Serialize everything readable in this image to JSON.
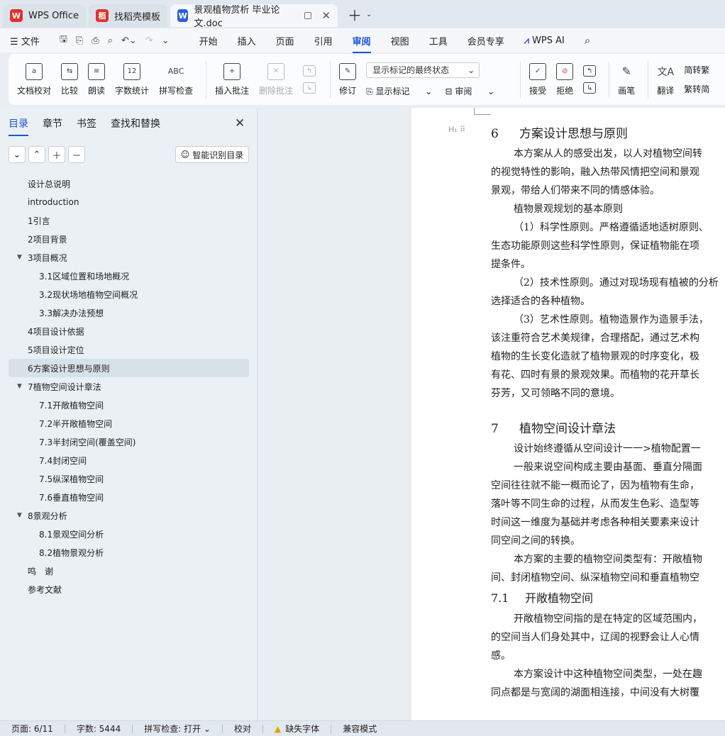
{
  "tabs": [
    {
      "label": "WPS Office",
      "state": "inactive",
      "logo": "W",
      "logo_color": "#e2302d"
    },
    {
      "label": "找稻壳模板",
      "state": "inactive",
      "logo": "稻",
      "logo_color": "#e2302d"
    },
    {
      "label": "景观植物赏析 毕业论文.doc",
      "state": "active",
      "logo": "W",
      "logo_color": "#2b5fd9"
    }
  ],
  "menu": {
    "file": "文件",
    "items": [
      "开始",
      "插入",
      "页面",
      "引用",
      "审阅",
      "视图",
      "工具",
      "会员专享"
    ],
    "active": "审阅",
    "ai": "WPS AI"
  },
  "ribbon": {
    "doc_proof": "文档校对",
    "compare": "比较",
    "read_aloud": "朗读",
    "word_count": "字数统计",
    "spell_check": "拼写检查",
    "insert_comment": "插入批注",
    "delete_comment": "删除批注",
    "track": "修订",
    "markup_view": "显示标记的最终状态",
    "show_markup": "显示标记",
    "review": "审阅",
    "accept": "接受",
    "reject": "拒绝",
    "pen": "画笔",
    "translate": "翻译",
    "to_trad": "简转繁",
    "to_simp": "繁转简"
  },
  "panel": {
    "tabs": [
      "目录",
      "章节",
      "书签",
      "查找和替换"
    ],
    "active_tab": "目录",
    "smart_toc": "智能识别目录",
    "toc": [
      {
        "label": "设计总说明",
        "level": 1
      },
      {
        "label": "introduction",
        "level": 1
      },
      {
        "label": "1引言",
        "level": 1
      },
      {
        "label": "2项目背景",
        "level": 1
      },
      {
        "label": "3项目概况",
        "level": 1,
        "expanded": true
      },
      {
        "label": "3.1区域位置和场地概况",
        "level": 2
      },
      {
        "label": "3.2现状场地植物空间概况",
        "level": 2
      },
      {
        "label": "3.3解决办法预想",
        "level": 2
      },
      {
        "label": "4项目设计依据",
        "level": 1
      },
      {
        "label": "5项目设计定位",
        "level": 1
      },
      {
        "label": "6方案设计思想与原则",
        "level": 1,
        "selected": true
      },
      {
        "label": "7植物空间设计章法",
        "level": 1,
        "expanded": true
      },
      {
        "label": "7.1开敞植物空间",
        "level": 2
      },
      {
        "label": "7.2半开敞植物空间",
        "level": 2
      },
      {
        "label": "7.3半封闭空间(覆盖空间)",
        "level": 2
      },
      {
        "label": "7.4封闭空间",
        "level": 2
      },
      {
        "label": "7.5纵深植物空间",
        "level": 2
      },
      {
        "label": "7.6垂直植物空间",
        "level": 2
      },
      {
        "label": "8景观分析",
        "level": 1,
        "expanded": true
      },
      {
        "label": "8.1景观空间分析",
        "level": 2
      },
      {
        "label": "8.2植物景观分析",
        "level": 2
      },
      {
        "label": "鸣　谢",
        "level": 1
      },
      {
        "label": "参考文献",
        "level": 1
      }
    ]
  },
  "document": {
    "h6_num": "6",
    "h6_title": "方案设计思想与原则",
    "lines": [
      {
        "text": "本方案从人的感受出发，以人对植物空间转",
        "indent": true
      },
      {
        "text": "的视觉特性的影响，融入热带风情把空间和景观",
        "indent": false
      },
      {
        "text": "景观，带给人们带来不同的情感体验。",
        "indent": false
      },
      {
        "text": "植物景观规划的基本原则",
        "indent": true
      },
      {
        "text": "（1）科学性原则。严格遵循适地适树原则、",
        "indent": true
      },
      {
        "text": "生态功能原则这些科学性原则，保证植物能在项",
        "indent": false
      },
      {
        "text": "提条件。",
        "indent": false
      },
      {
        "text": "（2）技术性原则。通过对现场现有植被的分析",
        "indent": true
      },
      {
        "text": "选择适合的各种植物。",
        "indent": false
      },
      {
        "text": "（3）艺术性原则。植物造景作为造景手法，",
        "indent": true
      },
      {
        "text": "该注重符合艺术美规律，合理搭配，通过艺术构",
        "indent": false
      },
      {
        "text": "植物的生长变化造就了植物景观的时序变化，极",
        "indent": false
      },
      {
        "text": "有花、四时有景的景观效果。而植物的花开草长",
        "indent": false
      },
      {
        "text": "芬芳，又可领略不同的意境。",
        "indent": false
      }
    ],
    "h7_num": "7",
    "h7_title": "植物空间设计章法",
    "lines7": [
      {
        "text": "设计始终遵循从空间设计一一>植物配置一",
        "indent": true
      },
      {
        "text": "一般来说空间构成主要由基面、垂直分隔面",
        "indent": true
      },
      {
        "text": "空间往往就不能一概而论了，因为植物有生命，",
        "indent": false
      },
      {
        "text": "落叶等不同生命的过程，从而发生色彩、造型等",
        "indent": false
      },
      {
        "text": "时间这一维度为基础并考虑各种相关要素来设计",
        "indent": false
      },
      {
        "text": "同空间之间的转换。",
        "indent": false
      },
      {
        "text": "本方案的主要的植物空间类型有：开敞植物",
        "indent": true
      },
      {
        "text": "间、封闭植物空间、纵深植物空间和垂直植物空",
        "indent": false
      }
    ],
    "h71_num": "7.1",
    "h71_title": "开敞植物空间",
    "lines71": [
      {
        "text": "开敞植物空间指的是在特定的区域范围内，",
        "indent": true
      },
      {
        "text": "的空间当人们身处其中，辽阔的视野会让人心情",
        "indent": false
      },
      {
        "text": "感。",
        "indent": false
      },
      {
        "text": "本方案设计中这种植物空间类型，一处在趣",
        "indent": true
      },
      {
        "text": "同点都是与宽阔的湖面相连接，中间没有大树覆",
        "indent": false
      }
    ]
  },
  "status": {
    "page": "页面: 6/11",
    "words": "字数: 5444",
    "spell": "拼写检查: 打开",
    "proof": "校对",
    "missing_font": "缺失字体",
    "compat": "兼容模式"
  }
}
